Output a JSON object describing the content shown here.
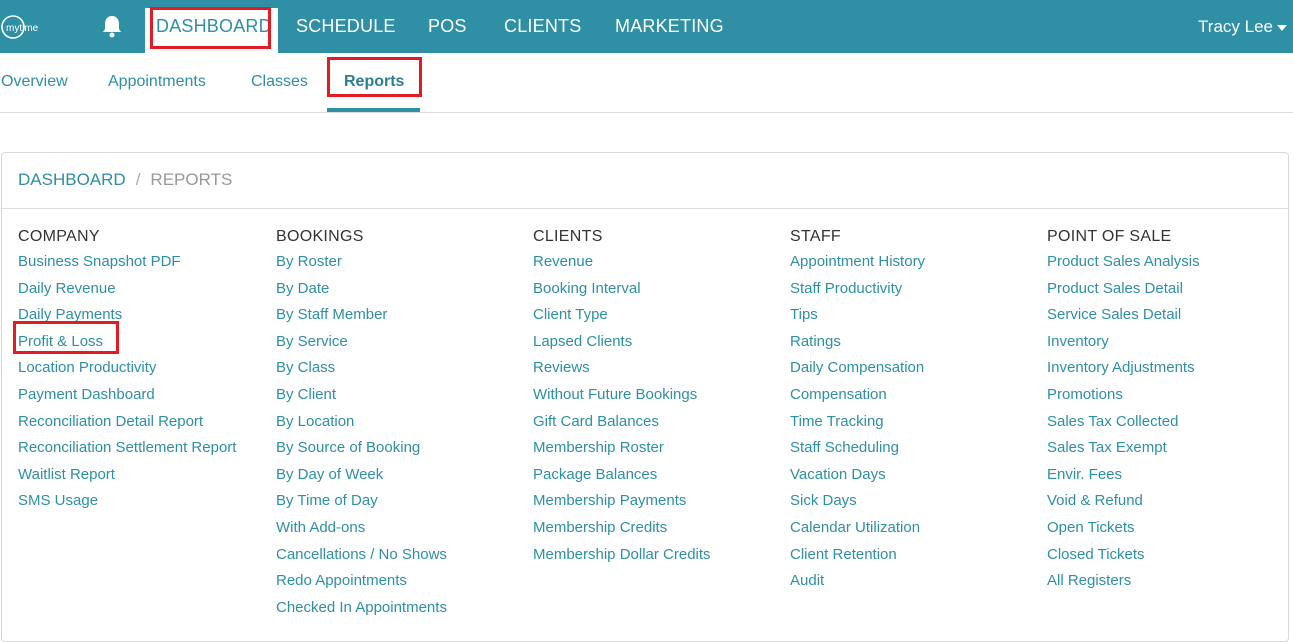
{
  "topnav": {
    "logo_text": "mytime",
    "items": [
      "DASHBOARD",
      "SCHEDULE",
      "POS",
      "CLIENTS",
      "MARKETING"
    ],
    "user_name": "Tracy Lee"
  },
  "subnav": {
    "items": [
      "Overview",
      "Appointments",
      "Classes",
      "Reports"
    ]
  },
  "breadcrumb": {
    "root": "DASHBOARD",
    "separator": "/",
    "current": "REPORTS"
  },
  "columns": [
    {
      "title": "COMPANY",
      "items": [
        "Business Snapshot PDF",
        "Daily Revenue",
        "Daily Payments",
        "Profit & Loss",
        "Location Productivity",
        "Payment Dashboard",
        "Reconciliation Detail Report",
        "Reconciliation Settlement Report",
        "Waitlist Report",
        "SMS Usage"
      ]
    },
    {
      "title": "BOOKINGS",
      "items": [
        "By Roster",
        "By Date",
        "By Staff Member",
        "By Service",
        "By Class",
        "By Client",
        "By Location",
        "By Source of Booking",
        "By Day of Week",
        "By Time of Day",
        "With Add-ons",
        "Cancellations / No Shows",
        "Redo Appointments",
        "Checked In Appointments"
      ]
    },
    {
      "title": "CLIENTS",
      "items": [
        "Revenue",
        "Booking Interval",
        "Client Type",
        "Lapsed Clients",
        "Reviews",
        "Without Future Bookings",
        "Gift Card Balances",
        "Membership Roster",
        "Package Balances",
        "Membership Payments",
        "Membership Credits",
        "Membership Dollar Credits"
      ]
    },
    {
      "title": "STAFF",
      "items": [
        "Appointment History",
        "Staff Productivity",
        "Tips",
        "Ratings",
        "Daily Compensation",
        "Compensation",
        "Time Tracking",
        "Staff Scheduling",
        "Vacation Days",
        "Sick Days",
        "Calendar Utilization",
        "Client Retention",
        "Audit"
      ]
    },
    {
      "title": "POINT OF SALE",
      "items": [
        "Product Sales Analysis",
        "Product Sales Detail",
        "Service Sales Detail",
        "Inventory",
        "Inventory Adjustments",
        "Promotions",
        "Sales Tax Collected",
        "Sales Tax Exempt",
        "Envir. Fees",
        "Void & Refund",
        "Open Tickets",
        "Closed Tickets",
        "All Registers"
      ]
    }
  ],
  "colors": {
    "brand": "#2e8fa5",
    "highlight": "#e31b23"
  }
}
